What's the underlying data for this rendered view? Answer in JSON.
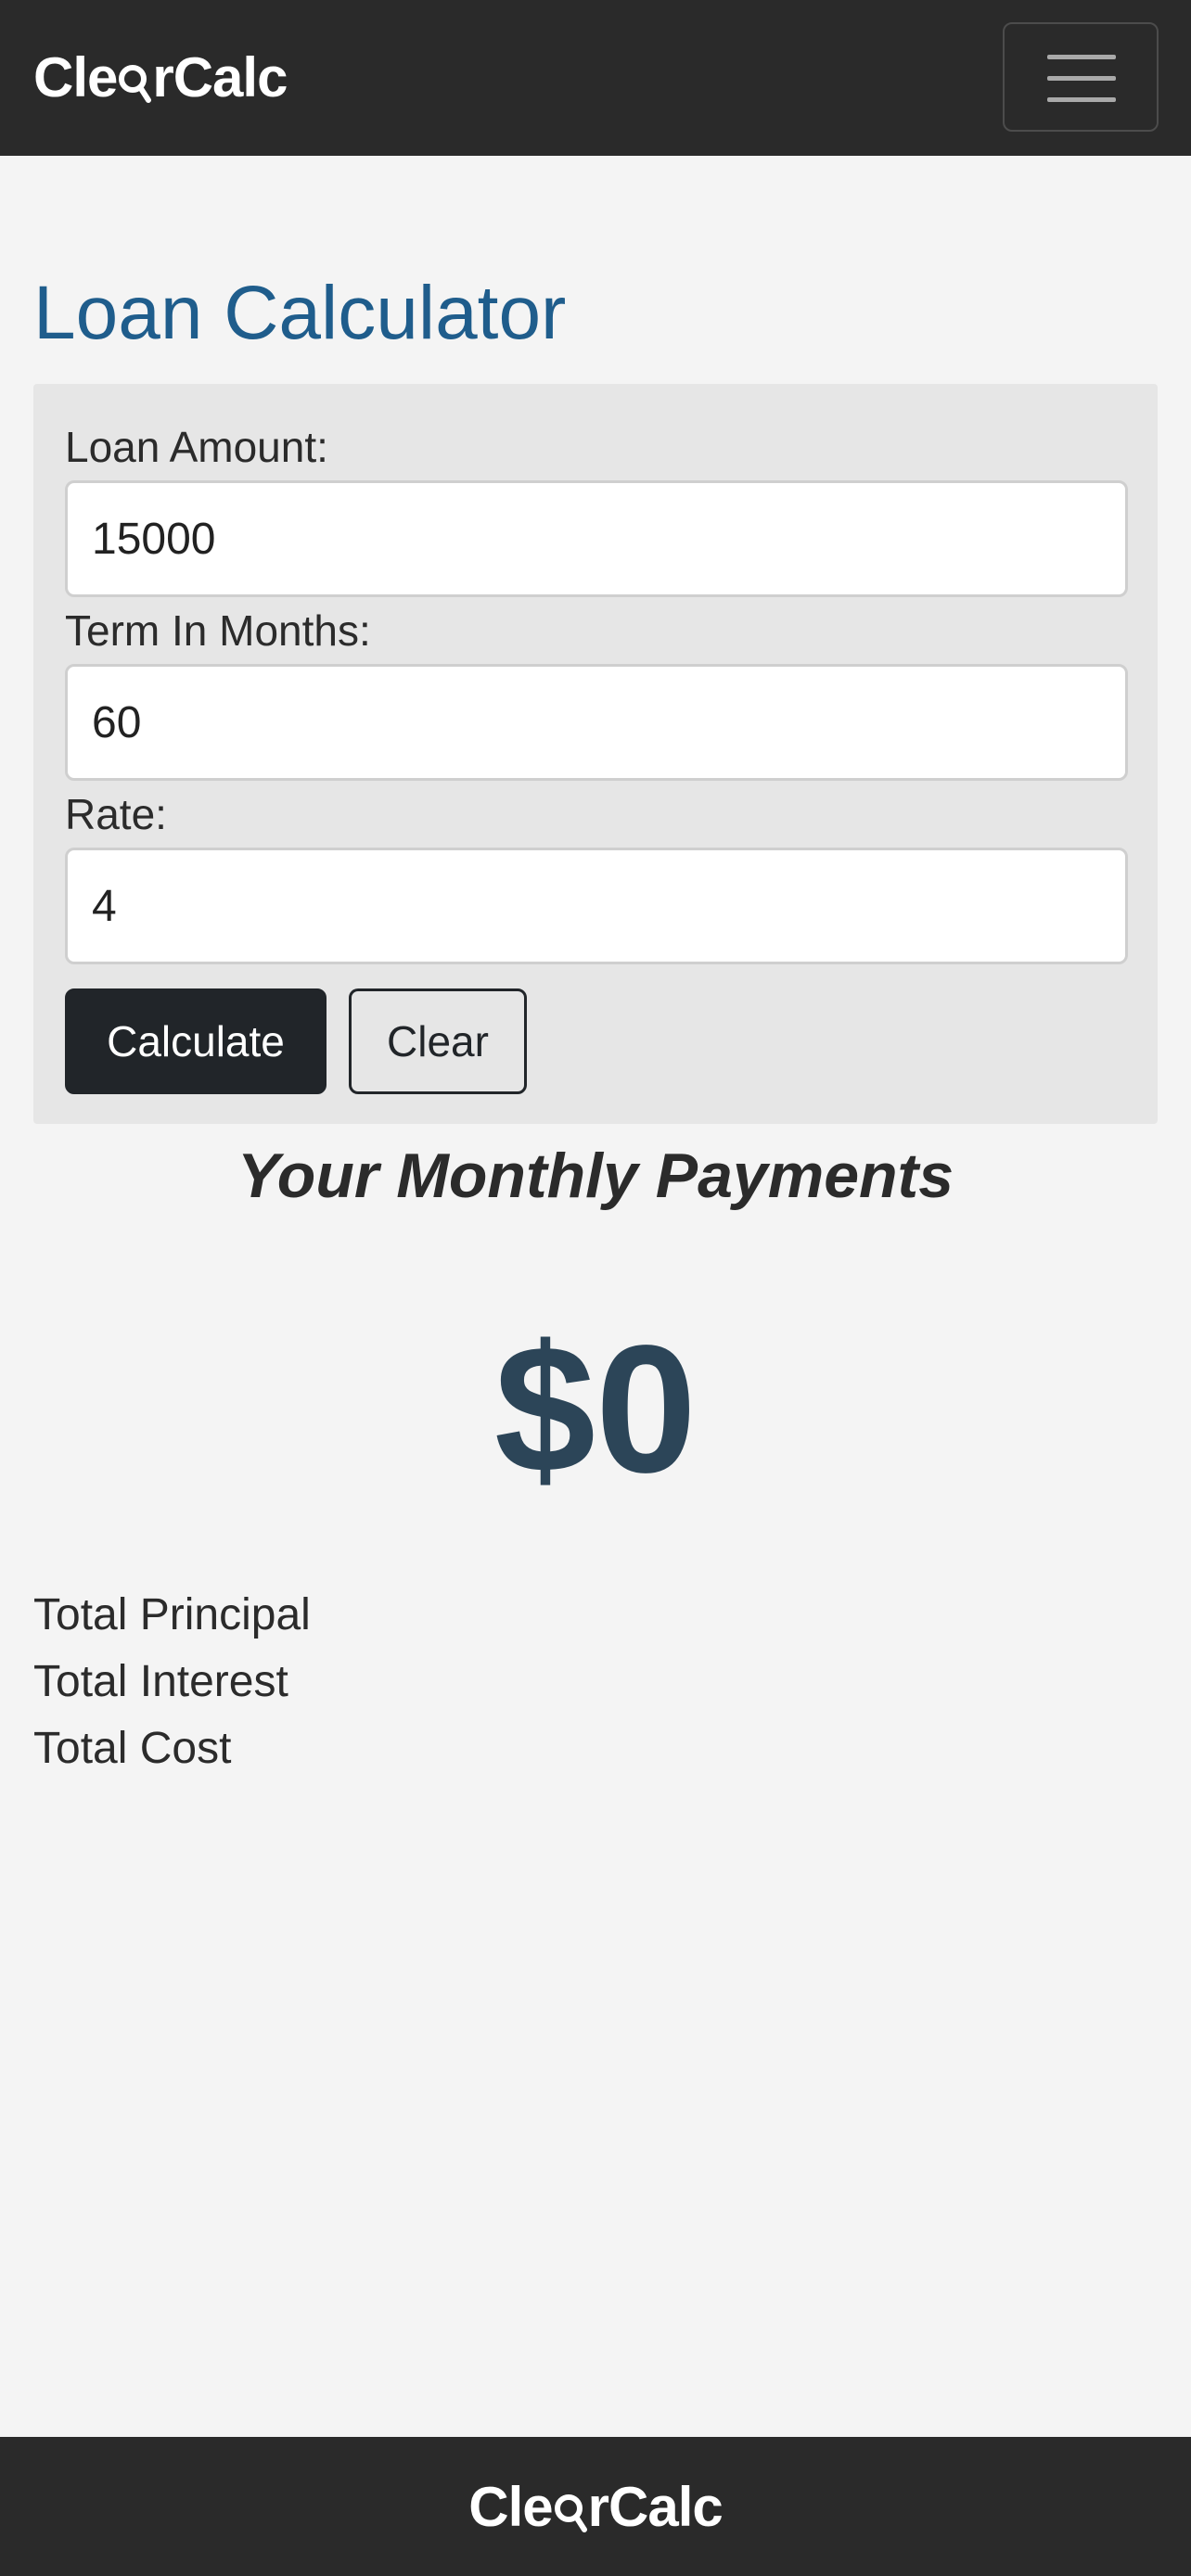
{
  "navbar": {
    "brand_prefix": "Cle",
    "brand_suffix": "rCalc",
    "brand_icon": "magnifier-icon",
    "menu_icon": "hamburger-menu-icon"
  },
  "main": {
    "title": "Loan Calculator"
  },
  "form": {
    "loan_amount_label": "Loan Amount:",
    "loan_amount_value": "15000",
    "term_label": "Term In Months:",
    "term_value": "60",
    "rate_label": "Rate:",
    "rate_value": "4",
    "calculate_label": "Calculate",
    "clear_label": "Clear"
  },
  "results": {
    "heading": "Your Monthly Payments",
    "monthly_payment": "$0",
    "rows": [
      {
        "label": "Total Principal"
      },
      {
        "label": "Total Interest"
      },
      {
        "label": "Total Cost"
      }
    ]
  },
  "footer": {
    "brand_prefix": "Cle",
    "brand_suffix": "rCalc"
  },
  "colors": {
    "navbar_bg": "#2a2a2a",
    "title": "#1f5d8c",
    "payment": "#2c4558",
    "primary_button": "#212529"
  }
}
